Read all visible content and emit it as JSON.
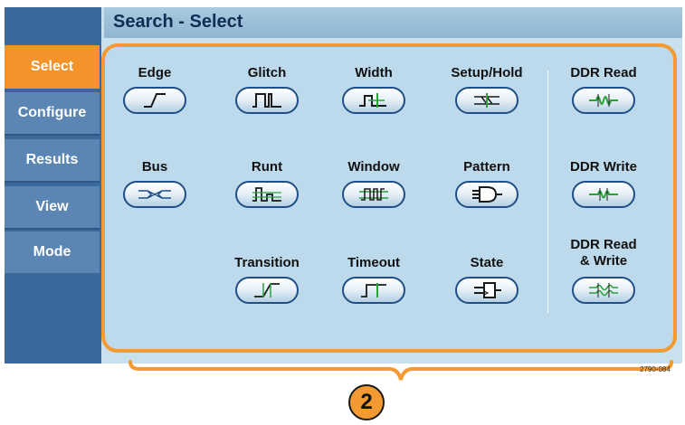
{
  "window": {
    "title": "Search - Select"
  },
  "nav": {
    "items": [
      {
        "label": "Select",
        "active": true
      },
      {
        "label": "Configure",
        "active": false
      },
      {
        "label": "Results",
        "active": false
      },
      {
        "label": "View",
        "active": false
      },
      {
        "label": "Mode",
        "active": false
      }
    ]
  },
  "search_types": {
    "edge": {
      "label": "Edge",
      "icon": "edge-waveform-icon"
    },
    "glitch": {
      "label": "Glitch",
      "icon": "glitch-waveform-icon"
    },
    "width": {
      "label": "Width",
      "icon": "width-waveform-icon"
    },
    "setup_hold": {
      "label": "Setup/Hold",
      "icon": "setup-hold-icon"
    },
    "ddr_read": {
      "label": "DDR Read",
      "icon": "ddr-read-icon"
    },
    "bus": {
      "label": "Bus",
      "icon": "bus-icon"
    },
    "runt": {
      "label": "Runt",
      "icon": "runt-waveform-icon"
    },
    "window": {
      "label": "Window",
      "icon": "window-waveform-icon"
    },
    "pattern": {
      "label": "Pattern",
      "icon": "logic-gate-icon"
    },
    "ddr_write": {
      "label": "DDR Write",
      "icon": "ddr-write-icon"
    },
    "transition": {
      "label": "Transition",
      "icon": "transition-waveform-icon"
    },
    "timeout": {
      "label": "Timeout",
      "icon": "timeout-waveform-icon"
    },
    "state": {
      "label": "State",
      "icon": "state-flipflop-icon"
    },
    "ddr_read_write": {
      "label_line1": "DDR Read",
      "label_line2": "& Write",
      "icon": "ddr-read-write-icon"
    }
  },
  "callout": {
    "number": "2"
  },
  "figure_id": "2790-084",
  "colors": {
    "accent": "#f39a33",
    "panel": "#bcdaeb",
    "nav": "#5b86b3",
    "title": "#0f2e55",
    "wave": "#2aa23a"
  }
}
